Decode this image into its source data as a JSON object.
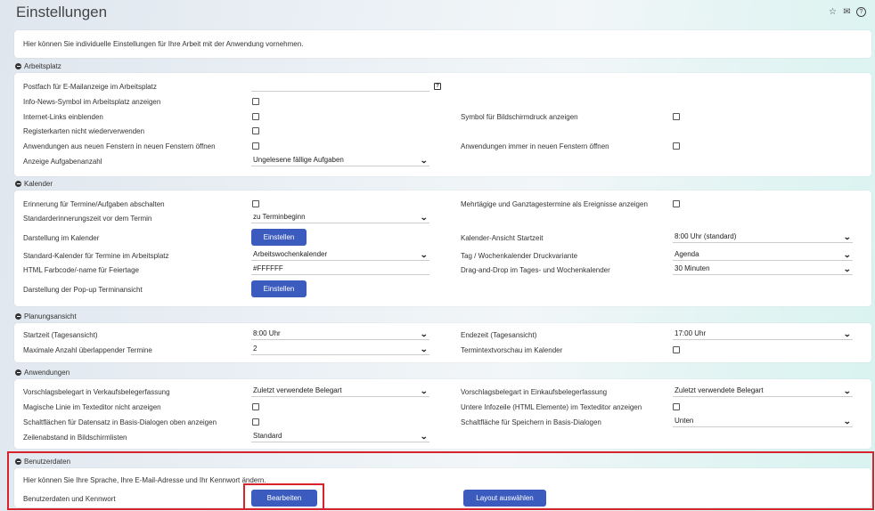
{
  "page_title": "Einstellungen",
  "intro": "Hier können Sie individuelle Einstellungen für Ihre Arbeit mit der Anwendung vornehmen.",
  "icons": {
    "star": "star-icon",
    "mail": "mail-icon",
    "help": "help-circle-icon"
  },
  "colors": {
    "button": "#3b5bbf",
    "highlight": "#d8232a"
  },
  "arbeitsplatz": {
    "header": "Arbeitsplatz",
    "postfach": "Postfach für E-Mailanzeige im Arbeitsplatz",
    "info_news": "Info-News-Symbol im Arbeitsplatz anzeigen",
    "internet_links": "Internet-Links einblenden",
    "symbol_druck": "Symbol für Bildschirmdruck anzeigen",
    "registerkarten": "Registerkarten nicht wiederverwenden",
    "anwendungen_neue": "Anwendungen aus neuen Fenstern in neuen Fenstern öffnen",
    "anwendungen_immer": "Anwendungen immer in neuen Fenstern öffnen",
    "aufgaben_label": "Anzeige Aufgabenanzahl",
    "aufgaben_value": "Ungelesene fällige Aufgaben"
  },
  "kalender": {
    "header": "Kalender",
    "erinnerung": "Erinnerung für Termine/Aufgaben abschalten",
    "mehrtaegig": "Mehrtägige und Ganztagestermine als Ereignisse anzeigen",
    "standard_erinnerung_label": "Standarderinnerungszeit vor dem Termin",
    "standard_erinnerung_value": "zu Terminbeginn",
    "darstellung_label": "Darstellung im Kalender",
    "einstellen": "Einstellen",
    "ansicht_start_label": "Kalender-Ansicht Startzeit",
    "ansicht_start_value": "8:00 Uhr (standard)",
    "standard_kalender_label": "Standard-Kalender für Termine im Arbeitsplatz",
    "standard_kalender_value": "Arbeitswochenkalender",
    "druckvariante_label": "Tag / Wochenkalender Druckvariante",
    "druckvariante_value": "Agenda",
    "farbcode_label": "HTML Farbcode/-name für Feiertage",
    "farbcode_value": "#FFFFFF",
    "dragdrop_label": "Drag-and-Drop im Tages- und Wochenkalender",
    "dragdrop_value": "30 Minuten",
    "popup_label": "Darstellung der Pop-up Terminansicht"
  },
  "planung": {
    "header": "Planungsansicht",
    "startzeit_label": "Startzeit (Tagesansicht)",
    "startzeit_value": "8:00 Uhr",
    "endezeit_label": "Endezeit (Tagesansicht)",
    "endezeit_value": "17:00 Uhr",
    "max_label": "Maximale Anzahl überlappender Termine",
    "max_value": "2",
    "vorschau_label": "Termintextvorschau im Kalender"
  },
  "anwendungen": {
    "header": "Anwendungen",
    "verkauf_label": "Vorschlagsbelegart in Verkaufsbelegerfassung",
    "verkauf_value": "Zuletzt verwendete Belegart",
    "einkauf_label": "Vorschlagsbelegart in Einkaufsbelegerfassung",
    "einkauf_value": "Zuletzt verwendete Belegart",
    "magische": "Magische Linie im Texteditor nicht anzeigen",
    "untere": "Untere Infozeile (HTML Elemente) im Texteditor anzeigen",
    "schaltflaechen": "Schaltflächen für Datensatz in Basis-Dialogen oben anzeigen",
    "speichern_label": "Schaltfläche für Speichern in Basis-Dialogen",
    "speichern_value": "Unten",
    "zeilenabstand_label": "Zeilenabstand in Bildschirmlisten",
    "zeilenabstand_value": "Standard"
  },
  "benutzer": {
    "header": "Benutzerdaten",
    "text": "Hier können Sie Ihre Sprache, Ihre E-Mail-Adresse und Ihr Kennwort ändern.",
    "label": "Benutzerdaten und Kennwort",
    "bearbeiten": "Bearbeiten",
    "layout": "Layout auswählen"
  }
}
